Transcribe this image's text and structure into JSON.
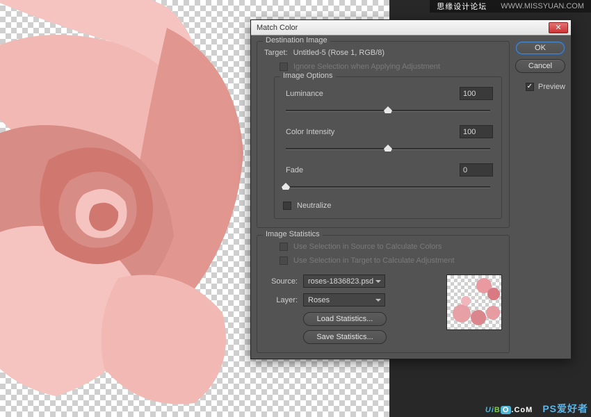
{
  "banner": {
    "site1": "思缘设计论坛",
    "site2": "WWW.MISSYUAN.COM"
  },
  "logo": {
    "text": "UiBO.CoM",
    "ps": "PS爱好者"
  },
  "dialog": {
    "title": "Match Color",
    "destination": {
      "legend": "Destination Image",
      "target_label": "Target:",
      "target_value": "Untitled-5 (Rose 1, RGB/8)",
      "ignore_label": "Ignore Selection when Applying Adjustment",
      "options": {
        "legend": "Image Options",
        "luminance_label": "Luminance",
        "luminance_value": "100",
        "intensity_label": "Color Intensity",
        "intensity_value": "100",
        "fade_label": "Fade",
        "fade_value": "0",
        "neutralize_label": "Neutralize"
      }
    },
    "statistics": {
      "legend": "Image Statistics",
      "use_source_label": "Use Selection in Source to Calculate Colors",
      "use_target_label": "Use Selection in Target to Calculate Adjustment",
      "source_label": "Source:",
      "source_value": "roses-1836823.psd",
      "layer_label": "Layer:",
      "layer_value": "Roses",
      "load_label": "Load Statistics...",
      "save_label": "Save Statistics..."
    },
    "buttons": {
      "ok": "OK",
      "cancel": "Cancel",
      "preview": "Preview"
    }
  }
}
